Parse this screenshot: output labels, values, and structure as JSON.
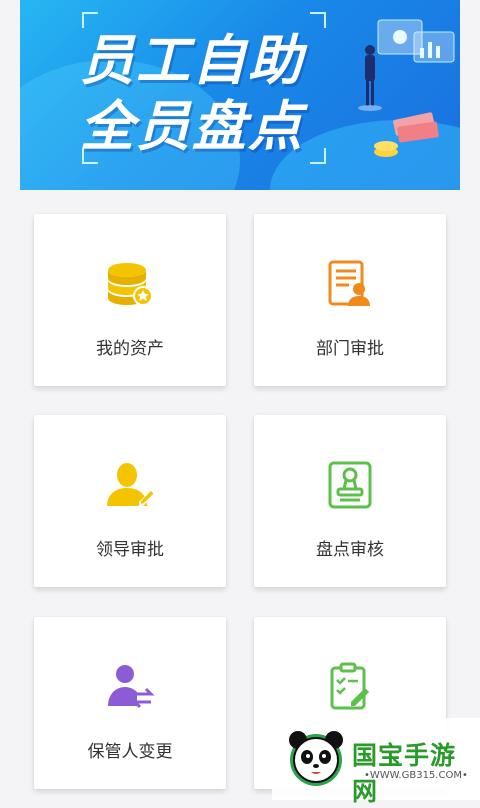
{
  "banner": {
    "line1": "员工自助",
    "line2": "全员盘点"
  },
  "menu": [
    {
      "label": "我的资产",
      "icon": "coins-icon",
      "color": "#f2b600"
    },
    {
      "label": "部门审批",
      "icon": "document-user-icon",
      "color": "#f08a1c"
    },
    {
      "label": "领导审批",
      "icon": "user-edit-icon",
      "color": "#f2b600"
    },
    {
      "label": "盘点审核",
      "icon": "stamp-icon",
      "color": "#5cc04a"
    },
    {
      "label": "保管人变更",
      "icon": "user-transfer-icon",
      "color": "#8b5cd6"
    },
    {
      "label": "",
      "icon": "checklist-icon",
      "color": "#5cc04a"
    }
  ],
  "watermark": {
    "brand": "国宝手游网",
    "url": "•WWW.GB315.COM•"
  }
}
